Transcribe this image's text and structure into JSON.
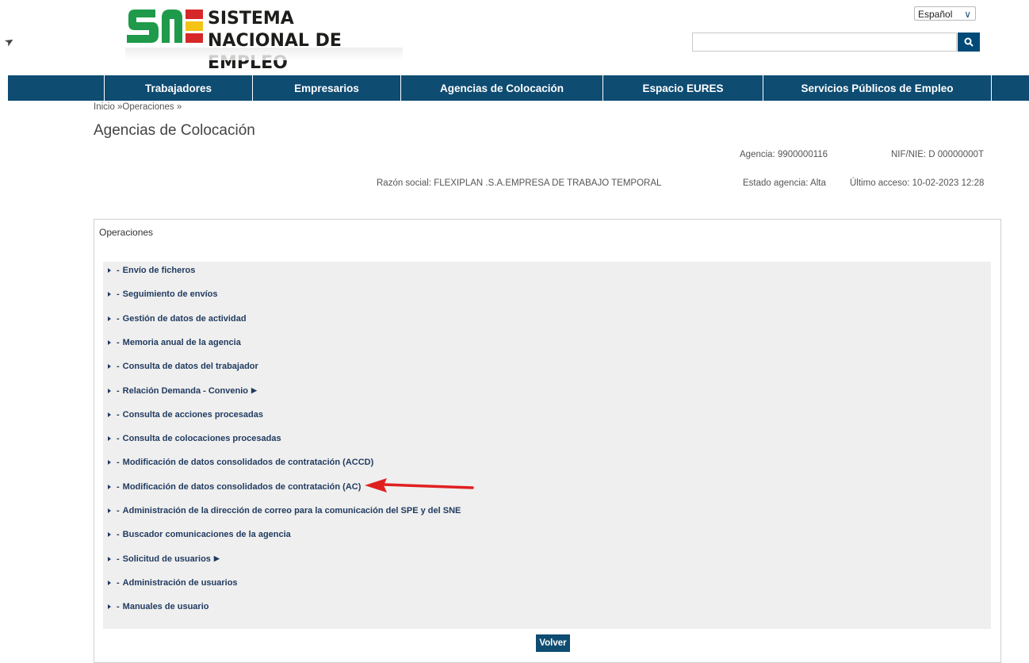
{
  "header": {
    "logo_line1": "SISTEMA",
    "logo_line2": "NACIONAL DE EMPLEO",
    "language": "Español",
    "search_placeholder": ""
  },
  "nav": {
    "items": [
      "Trabajadores",
      "Empresarios",
      "Agencias de Colocación",
      "Espacio EURES",
      "Servicios Públicos de Empleo"
    ]
  },
  "breadcrumb": "Inicio »Operaciones »",
  "page_title": "Agencias de Colocación",
  "agency": {
    "agencia": "Agencia: 9900000116",
    "nif": "NIF/NIE: D 00000000T",
    "razon_social": "Razón social: FLEXIPLAN .S.A.EMPRESA DE TRABAJO TEMPORAL",
    "estado": "Estado agencia: Alta",
    "ultimo_acceso": "Último acceso: 10-02-2023 12:28"
  },
  "panel": {
    "title": "Operaciones",
    "operations": [
      {
        "label": "Envío de ficheros",
        "submenu": false
      },
      {
        "label": "Seguimiento de envíos",
        "submenu": false
      },
      {
        "label": "Gestión de datos de actividad",
        "submenu": false
      },
      {
        "label": "Memoria anual de la agencia",
        "submenu": false
      },
      {
        "label": "Consulta de datos del trabajador",
        "submenu": false
      },
      {
        "label": "Relación Demanda - Convenio",
        "submenu": true
      },
      {
        "label": "Consulta de acciones procesadas",
        "submenu": false
      },
      {
        "label": "Consulta de colocaciones procesadas",
        "submenu": false
      },
      {
        "label": "Modificación de datos consolidados de contratación (ACCD)",
        "submenu": false
      },
      {
        "label": "Modificación de datos consolidados de contratación (AC)",
        "submenu": false
      },
      {
        "label": "Administración de la dirección de correo para la comunicación del SPE y del SNE",
        "submenu": false
      },
      {
        "label": "Buscador comunicaciones de la agencia",
        "submenu": false
      },
      {
        "label": "Solicitud de usuarios",
        "submenu": true
      },
      {
        "label": "Administración de usuarios",
        "submenu": false
      },
      {
        "label": "Manuales de usuario",
        "submenu": false
      }
    ],
    "volver": "Volver"
  },
  "colors": {
    "nav_bg": "#0e4c72",
    "link": "#1f3a5f",
    "logo_green": "#1e9a4a",
    "logo_red": "#d62828",
    "logo_yellow": "#f3c316",
    "arrow": "#e02020"
  }
}
